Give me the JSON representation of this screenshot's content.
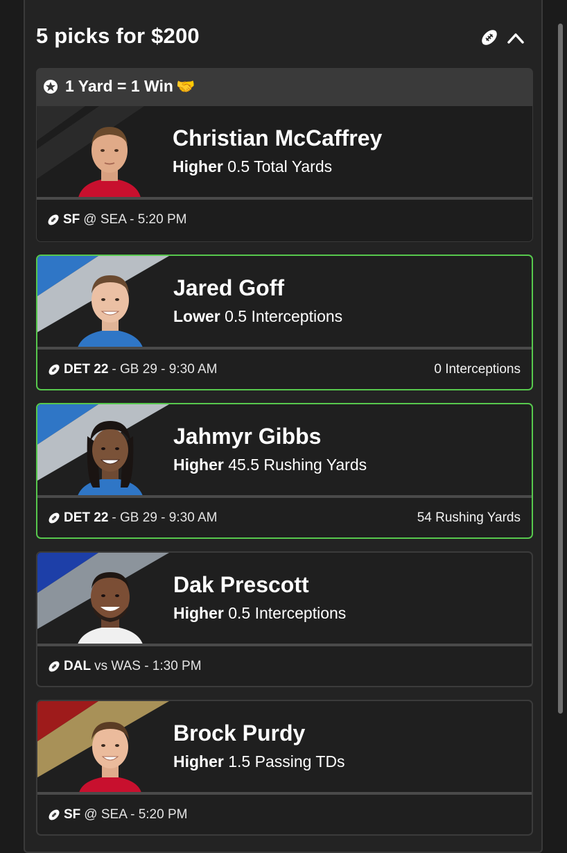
{
  "header": {
    "title": "5 picks for $200",
    "sport_icon": "football-icon",
    "collapse_icon": "chevron-up-icon"
  },
  "promo": {
    "icon": "star-icon",
    "label": "1 Yard = 1 Win",
    "emoji": "🤝"
  },
  "picks": [
    {
      "player": "Christian McCaffrey",
      "direction": "Higher",
      "line": "0.5 Total Yards",
      "team": "SF",
      "matchup": "@ SEA - 5:20 PM",
      "result": "",
      "status": "pending",
      "colors": {
        "primary": "#c8102e",
        "secondary": "#2b2b2b"
      }
    },
    {
      "player": "Jared Goff",
      "direction": "Lower",
      "line": "0.5 Interceptions",
      "team": "DET 22",
      "matchup": "- GB 29 - 9:30 AM",
      "result": "0 Interceptions",
      "status": "win",
      "colors": {
        "primary": "#2f76c6",
        "secondary": "#b8bec4"
      }
    },
    {
      "player": "Jahmyr Gibbs",
      "direction": "Higher",
      "line": "45.5 Rushing Yards",
      "team": "DET 22",
      "matchup": "- GB 29 - 9:30 AM",
      "result": "54 Rushing Yards",
      "status": "win",
      "colors": {
        "primary": "#2f76c6",
        "secondary": "#b8bec4"
      }
    },
    {
      "player": "Dak Prescott",
      "direction": "Higher",
      "line": "0.5 Interceptions",
      "team": "DAL",
      "matchup": "vs WAS - 1:30 PM",
      "result": "",
      "status": "pending",
      "colors": {
        "primary": "#1d3fa8",
        "secondary": "#8c949c"
      }
    },
    {
      "player": "Brock Purdy",
      "direction": "Higher",
      "line": "1.5 Passing TDs",
      "team": "SF",
      "matchup": "@ SEA - 5:20 PM",
      "result": "",
      "status": "pending",
      "colors": {
        "primary": "#9e1b1b",
        "secondary": "#a89158"
      }
    }
  ]
}
